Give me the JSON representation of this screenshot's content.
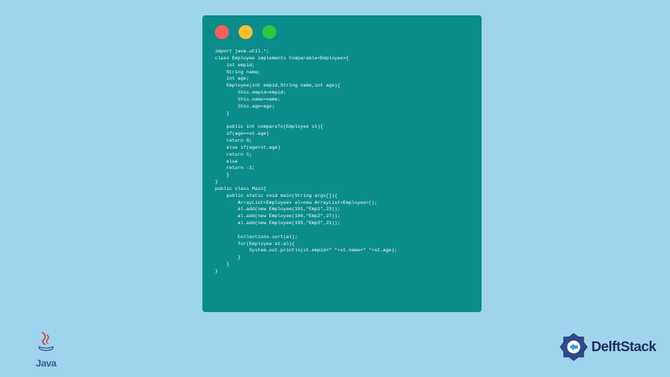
{
  "code": {
    "lines": [
      "import java.util.*;",
      "class Employee implements Comparable<Employee>{",
      "    int empid;",
      "    String name;",
      "    int age;",
      "    Employee(int empid,String name,int age){",
      "        this.empid=empid;",
      "        this.name=name;",
      "        this.age=age;",
      "    }",
      "",
      "    public int compareTo(Employee st){",
      "    if(age==st.age)",
      "    return 0;",
      "    else if(age>st.age)",
      "    return 1;",
      "    else",
      "    return -1;",
      "    }",
      "}",
      "public class Main{",
      "    public static void main(String args[]){",
      "        ArrayList<Employee> al=new ArrayList<Employee>();",
      "        al.add(new Employee(101,\"Emp1\",23));",
      "        al.add(new Employee(106,\"Emp2\",27));",
      "        al.add(new Employee(105,\"Emp3\",21));",
      "",
      "        Collections.sort(al);",
      "        for(Employee st:al){",
      "            System.out.println(st.empid+\" \"+st.name+\" \"+st.age);",
      "        }",
      "    }",
      "}"
    ]
  },
  "logos": {
    "java_label": "Java",
    "delft_label": "DelftStack"
  }
}
